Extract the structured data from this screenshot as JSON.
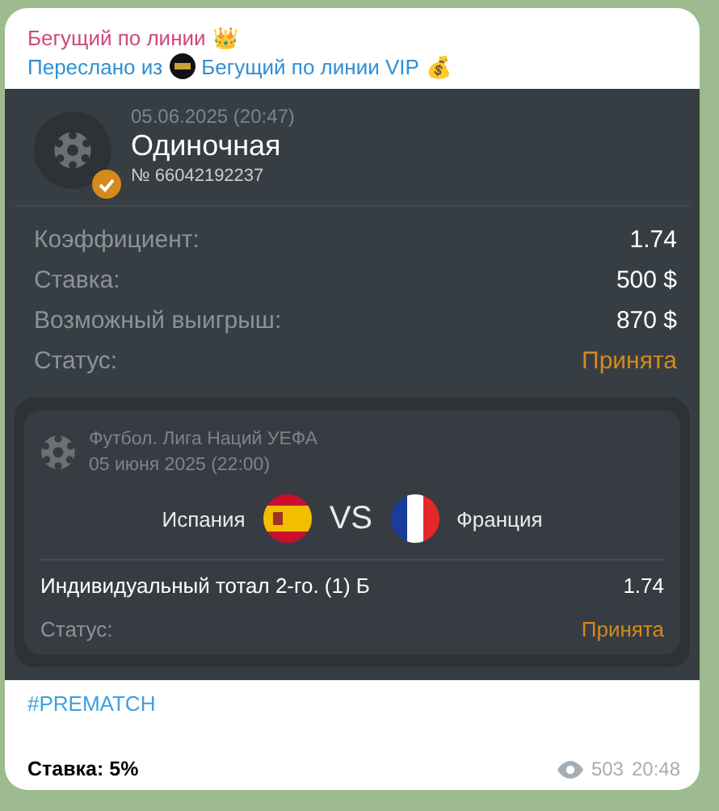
{
  "channel": {
    "name": "Бегущий по линии",
    "emoji": "👑"
  },
  "forward": {
    "prefix": "Переслано из",
    "source": "Бегущий по линии VIP",
    "emoji": "💰"
  },
  "bet": {
    "verified": true,
    "date": "05.06.2025 (20:47)",
    "type": "Одиночная",
    "number": "№ 66042192237",
    "details": [
      {
        "label": "Коэффициент:",
        "value": "1.74",
        "kind": "plain"
      },
      {
        "label": "Ставка:",
        "value": "500 $",
        "kind": "plain"
      },
      {
        "label": "Возможный выигрыш:",
        "value": "870 $",
        "kind": "plain"
      },
      {
        "label": "Статус:",
        "value": "Принята",
        "kind": "status"
      }
    ]
  },
  "event": {
    "league": "Футбол. Лига Наций УЕФА",
    "date": "05 июня 2025 (22:00)",
    "home": "Испания",
    "vs": "VS",
    "away": "Франция",
    "market": "Индивидуальный тотал 2-го. (1) Б",
    "odds": "1.74",
    "status_label": "Статус:",
    "status": "Принята"
  },
  "hashtag": "#PREMATCH",
  "stake_note": "Ставка: 5%",
  "views": "503",
  "time": "20:48"
}
